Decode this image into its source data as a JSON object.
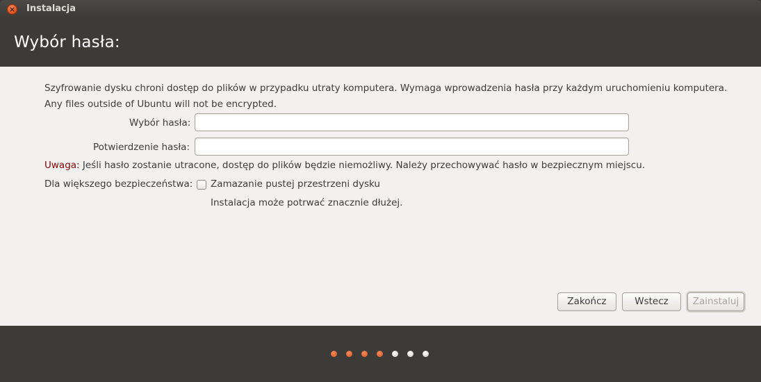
{
  "window": {
    "title": "Instalacja",
    "close_symbol": "×"
  },
  "header": {
    "title": "Wybór hasła:"
  },
  "content": {
    "description_line1": "Szyfrowanie dysku chroni dostęp do plików w przypadku utraty komputera. Wymaga wprowadzenia hasła przy każdym uruchomieniu komputera.",
    "description_line2": "Any files outside of Ubuntu will not be encrypted.",
    "password_label": "Wybór hasła:",
    "password_value": "",
    "confirm_label": "Potwierdzenie hasła:",
    "confirm_value": "",
    "warning_label": "Uwaga:",
    "warning_text": " Jeśli hasło zostanie utracone, dostęp do plików będzie niemożliwy. Należy przechowywać hasło w bezpiecznym miejscu.",
    "security_label": "Dla większego bezpieczeństwa:",
    "overwrite_checkbox_label": "Zamazanie pustej przestrzeni dysku",
    "overwrite_checked": false,
    "overwrite_hint": "Instalacja może potrwać znacznie dłużej."
  },
  "buttons": {
    "quit": "Zakończ",
    "back": "Wstecz",
    "install": "Zainstaluj",
    "install_enabled": false
  },
  "progress": {
    "total_steps": 7,
    "completed_steps": 4
  },
  "colors": {
    "accent": "#dd4814",
    "header_bg": "#3c3b37",
    "content_bg": "#f2f1f0",
    "warning": "#8b0000"
  }
}
